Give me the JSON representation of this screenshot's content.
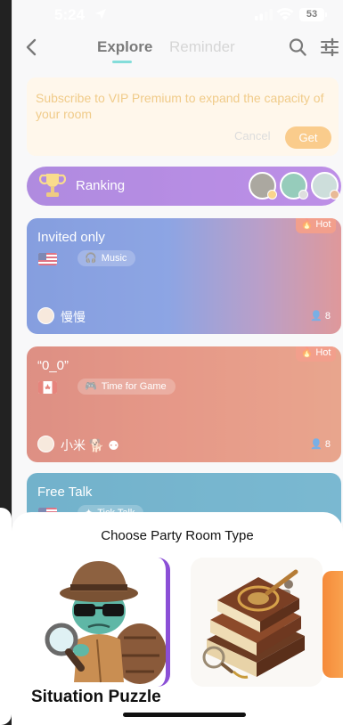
{
  "status_bar": {
    "time": "5:24",
    "battery": "53"
  },
  "nav": {
    "tab_explore": "Explore",
    "tab_reminder": "Reminder"
  },
  "vip_banner": {
    "message": "Subscribe to VIP Premium to expand the capacity of your room",
    "cancel_label": "Cancel",
    "get_label": "Get"
  },
  "ranking": {
    "label": "Ranking"
  },
  "rooms": [
    {
      "title": "Invited only",
      "badge": "Hot",
      "tag": "Music",
      "host": "慢慢",
      "count": "8",
      "flag": "us"
    },
    {
      "title": "“0_0”",
      "badge": "Hot",
      "tag": "Time for Game",
      "host": "小米",
      "count": "8",
      "flag": "ca"
    },
    {
      "title": "Free Talk",
      "tag": "Tick Talk",
      "flag": "us"
    }
  ],
  "sheet": {
    "title": "Choose Party Room Type",
    "options": [
      {
        "label": "Situation Puzzle"
      }
    ]
  },
  "colors": {
    "accent": "#2bc4c0",
    "vip_text": "#e6a534",
    "ranking_bg": "#7637c9",
    "hot_badge": "#e85a3a"
  }
}
